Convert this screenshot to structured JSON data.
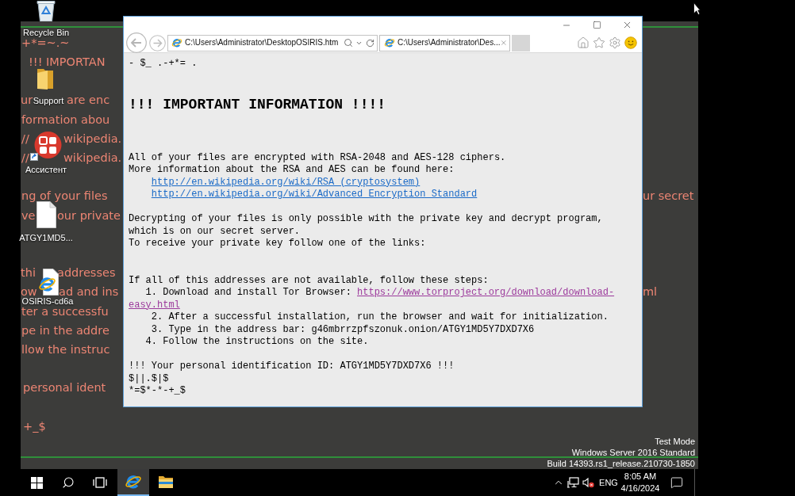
{
  "desktop": {
    "icons": [
      {
        "kind": "recycle-bin",
        "label": "Recycle Bin"
      },
      {
        "kind": "folder",
        "label": "Support"
      },
      {
        "kind": "app-shortcut",
        "label": "Ассистент"
      },
      {
        "kind": "file",
        "label": "ATGY1MD5..."
      },
      {
        "kind": "web-file",
        "label": "OSIRIS-cd6a"
      }
    ],
    "wallpaper_left": [
      {
        "segments": [
          "+*=~.~"
        ]
      },
      {
        "segments": [
          "!!! IMPORTAN"
        ]
      },
      {
        "segments": [
          "ur",
          "are enc"
        ]
      },
      {
        "segments": [
          "formation abou"
        ]
      },
      {
        "segments": [
          "//",
          "wikipedia."
        ]
      },
      {
        "segments": [
          "//",
          "wikipedia."
        ]
      },
      {
        "segments": [
          "ng of your files"
        ]
      },
      {
        "segments": [
          "ve",
          "our private"
        ]
      },
      {
        "segments": [
          "thi",
          "addresses"
        ]
      },
      {
        "segments": [
          "ow",
          "ad and ins"
        ]
      },
      {
        "segments": [
          "ter a successfu"
        ]
      },
      {
        "segments": [
          "pe in the addre"
        ]
      },
      {
        "segments": [
          "llow the instruc"
        ]
      },
      {
        "segments": [
          "personal ident"
        ]
      },
      {
        "segments": [
          "+_$"
        ]
      }
    ],
    "wallpaper_right": [
      {
        "segments": [
          "ur secret"
        ]
      },
      {
        "segments": [
          "ml"
        ]
      }
    ],
    "watermark": [
      "Test Mode",
      "Windows Server 2016 Standard",
      "Build 14393.rs1_release.210730-1850"
    ]
  },
  "browser": {
    "address": "C:\\Users\\Administrator\\DesktopOSIRIS.htm",
    "tabs": [
      {
        "title": "C:\\Users\\Administrator\\Des...",
        "selected": true
      }
    ],
    "page": {
      "preamble": "- $_ .-+*= .",
      "heading": "!!! IMPORTANT INFORMATION !!!!",
      "intro": [
        "All of your files are encrypted with RSA-2048 and AES-128 ciphers.",
        "More information about the RSA and AES can be found here:"
      ],
      "links": [
        {
          "text": "http://en.wikipedia.org/wiki/RSA_(cryptosystem)",
          "visited": false
        },
        {
          "text": "http://en.wikipedia.org/wiki/Advanced_Encryption_Standard",
          "visited": false
        }
      ],
      "decrypt": [
        "Decrypting of your files is only possible with the private key and decrypt program,",
        "which is on our secret server.",
        "To receive your private key follow one of the links:"
      ],
      "steps_intro": "If all of this addresses are not available, follow these steps:",
      "steps": [
        {
          "text": "1. Download and install Tor Browser:",
          "link": {
            "parts": [
              "https://www.torproject.org/download/download-",
              "easy.html"
            ],
            "visited": true
          }
        },
        {
          "text": "2. After a successful installation, run the browser and wait for initialization."
        },
        {
          "text": "3. Type in the address bar: g46mbrrzpfszonuk.onion/ATGY1MD5Y7DXD7X6"
        },
        {
          "text": "4. Follow the instructions on the site."
        }
      ],
      "id_line": "!!! Your personal identification ID: ATGY1MD5Y7DXD7X6 !!!",
      "footer": [
        "$||.$|$",
        "*=$*-*-+_$"
      ]
    }
  },
  "taskbar": {
    "apps": [
      {
        "kind": "ie",
        "active": true
      },
      {
        "kind": "explorer",
        "active": false
      }
    ],
    "language": "ENG",
    "time": "8:05 AM",
    "date": "4/16/2024"
  }
}
